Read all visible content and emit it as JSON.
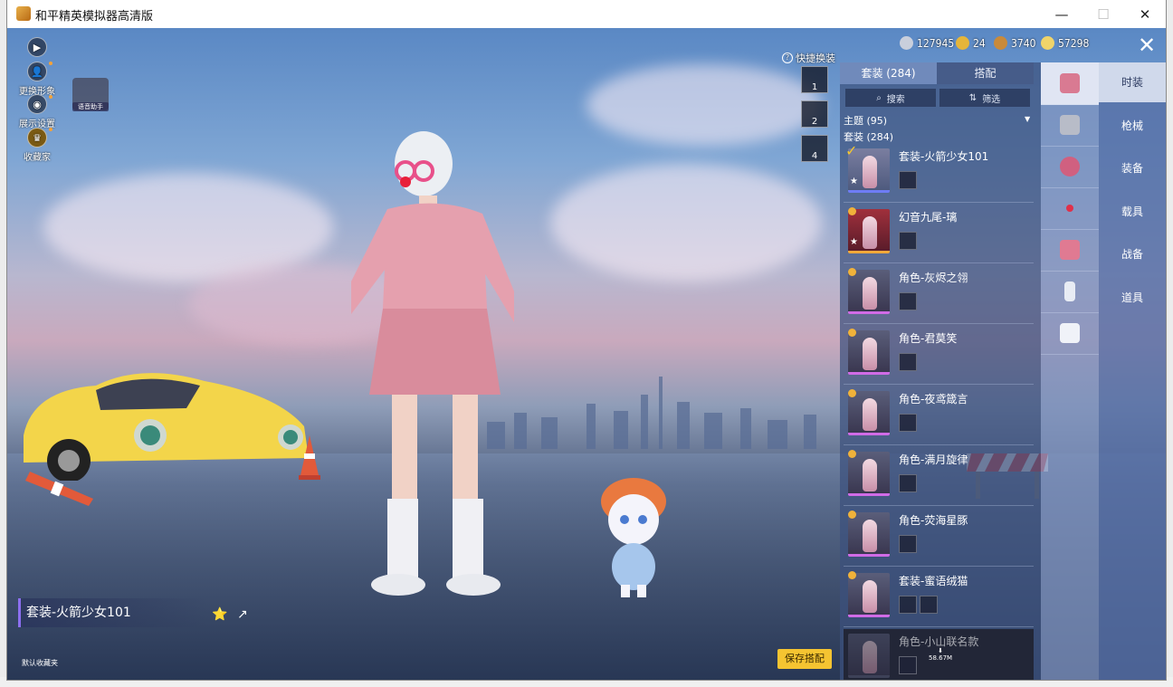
{
  "window": {
    "title": "和平精英模拟器高清版",
    "controls": {
      "minimize": "—",
      "maximize": "☐",
      "close": "✕"
    }
  },
  "left_tools": [
    {
      "name": "play",
      "label": ""
    },
    {
      "name": "change-avatar",
      "label": "更换形象"
    },
    {
      "name": "display-settings",
      "label": "展示设置"
    },
    {
      "name": "collection",
      "label": "收藏家"
    }
  ],
  "voice_assistant": "语音助手",
  "currencies": [
    {
      "icon": "silver-coin",
      "value": "127945",
      "color": "#c9cfdc"
    },
    {
      "icon": "gold-token",
      "value": "24",
      "color": "#e5b53a"
    },
    {
      "icon": "bronze-coin",
      "value": "3740",
      "color": "#c98a3a"
    },
    {
      "icon": "gold-coin",
      "value": "57298",
      "color": "#f0d46a"
    }
  ],
  "quick_swap": {
    "label": "快捷换装",
    "slots": [
      "1",
      "2",
      "4"
    ]
  },
  "panel": {
    "tabs": [
      {
        "label": "套装 (284)",
        "active": true
      },
      {
        "label": "搭配",
        "active": false
      }
    ],
    "search_label": "搜索",
    "filter_label": "筛选",
    "theme_label": "主题 (95)",
    "suits_label": "套装 (284)",
    "items": [
      {
        "name": "套装-火箭少女101",
        "rarity": "purple",
        "selected": true,
        "star": true,
        "minis": 1
      },
      {
        "name": "幻音九尾-璃",
        "rarity": "red",
        "selected": false,
        "star": true,
        "minis": 1
      },
      {
        "name": "角色-灰烬之翎",
        "rarity": "pink",
        "selected": false,
        "star": false,
        "minis": 1
      },
      {
        "name": "角色-君莫笑",
        "rarity": "pink",
        "selected": false,
        "star": false,
        "minis": 1
      },
      {
        "name": "角色-夜鸢箴言",
        "rarity": "pink",
        "selected": false,
        "star": false,
        "minis": 1
      },
      {
        "name": "角色-满月旋律",
        "rarity": "pink",
        "selected": false,
        "star": false,
        "minis": 1
      },
      {
        "name": "角色-荧海星豚",
        "rarity": "pink",
        "selected": false,
        "star": false,
        "minis": 1
      },
      {
        "name": "套装-蜜语绒猫",
        "rarity": "pink",
        "selected": false,
        "star": false,
        "minis": 2
      },
      {
        "name": "角色-小山联名款",
        "rarity": "dark",
        "selected": false,
        "star": false,
        "minis": 1,
        "download": "58.67M"
      }
    ]
  },
  "categories": [
    {
      "label": "时装",
      "icon": "outfit-icon",
      "active": true
    },
    {
      "label": "枪械",
      "icon": "gun-icon",
      "active": false
    },
    {
      "label": "装备",
      "icon": "gear-icon",
      "active": false
    },
    {
      "label": "载具",
      "icon": "vehicle-icon",
      "active": false
    },
    {
      "label": "战备",
      "icon": "supply-icon",
      "active": false
    },
    {
      "label": "道具",
      "icon": "prop-icon",
      "active": false
    }
  ],
  "extra_category_icons": [
    "pants-icon",
    "emote-icon"
  ],
  "outfit_display_name": "套装-火箭少女101",
  "default_favorite": "默认收藏夹",
  "save_button": "保存搭配"
}
